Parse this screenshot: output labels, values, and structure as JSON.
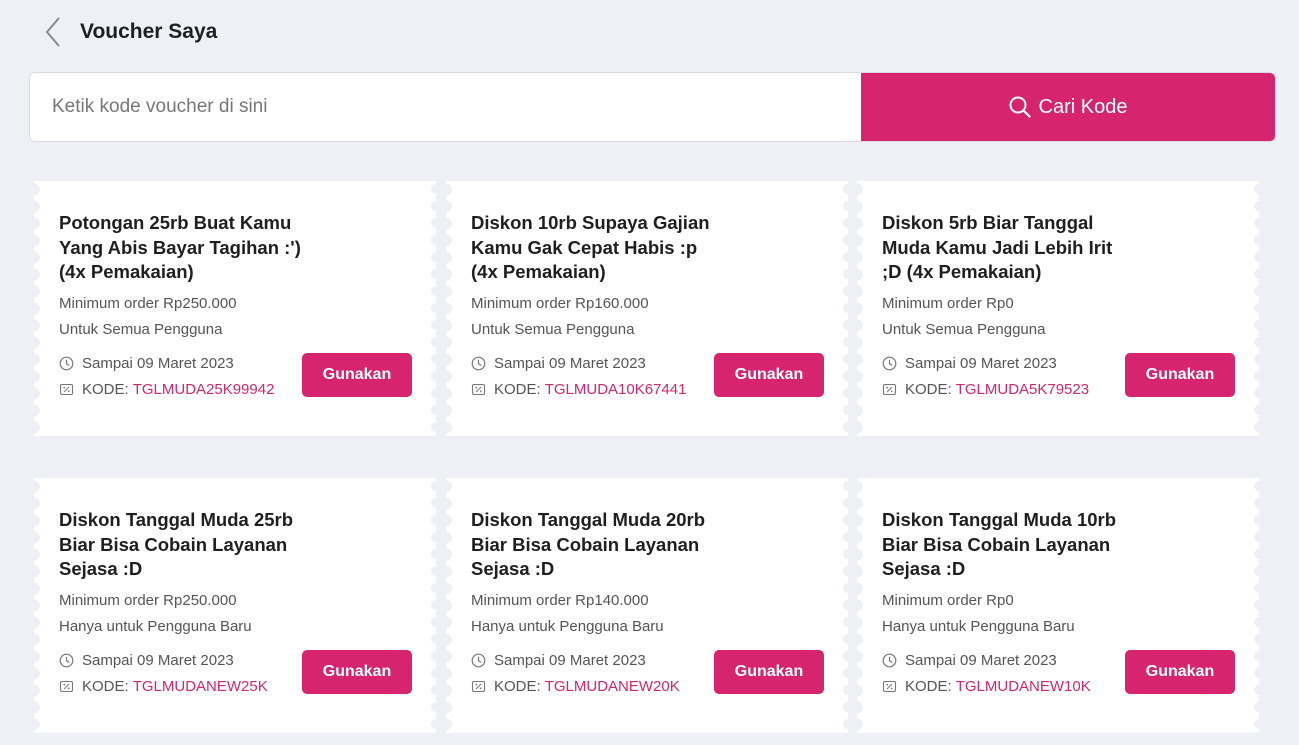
{
  "header": {
    "title": "Voucher Saya",
    "back_icon": "chevron-left-icon"
  },
  "search": {
    "placeholder": "Ketik kode voucher di sini",
    "value": "",
    "button_label": "Cari Kode",
    "button_icon": "search-icon"
  },
  "colors": {
    "accent": "#d6246e",
    "background": "#eef0f5",
    "card": "#ffffff"
  },
  "labels": {
    "expiry_prefix": "Sampai",
    "code_prefix": "KODE:",
    "use_button": "Gunakan"
  },
  "vouchers": [
    {
      "title": "Potongan 25rb Buat Kamu Yang Abis Bayar Tagihan :') (4x Pemakaian)",
      "min_order": "Minimum order Rp250.000",
      "users": "Untuk Semua Pengguna",
      "expiry": "Sampai 09 Maret 2023",
      "code_label": "KODE:",
      "code": "TGLMUDA25K99942",
      "button": "Gunakan"
    },
    {
      "title": "Diskon 10rb Supaya Gajian Kamu Gak Cepat Habis :p (4x Pemakaian)",
      "min_order": "Minimum order Rp160.000",
      "users": "Untuk Semua Pengguna",
      "expiry": "Sampai 09 Maret 2023",
      "code_label": "KODE:",
      "code": "TGLMUDA10K67441",
      "button": "Gunakan"
    },
    {
      "title": "Diskon 5rb Biar Tanggal Muda Kamu Jadi Lebih Irit ;D (4x Pemakaian)",
      "min_order": "Minimum order Rp0",
      "users": "Untuk Semua Pengguna",
      "expiry": "Sampai 09 Maret 2023",
      "code_label": "KODE:",
      "code": "TGLMUDA5K79523",
      "button": "Gunakan"
    },
    {
      "title": "Diskon Tanggal Muda 25rb Biar Bisa Cobain Layanan Sejasa :D",
      "min_order": "Minimum order Rp250.000",
      "users": "Hanya untuk Pengguna Baru",
      "expiry": "Sampai 09 Maret 2023",
      "code_label": "KODE:",
      "code": "TGLMUDANEW25K",
      "button": "Gunakan"
    },
    {
      "title": "Diskon Tanggal Muda 20rb Biar Bisa Cobain Layanan Sejasa :D",
      "min_order": "Minimum order Rp140.000",
      "users": "Hanya untuk Pengguna Baru",
      "expiry": "Sampai 09 Maret 2023",
      "code_label": "KODE:",
      "code": "TGLMUDANEW20K",
      "button": "Gunakan"
    },
    {
      "title": "Diskon Tanggal Muda 10rb Biar Bisa Cobain Layanan Sejasa :D",
      "min_order": "Minimum order Rp0",
      "users": "Hanya untuk Pengguna Baru",
      "expiry": "Sampai 09 Maret 2023",
      "code_label": "KODE:",
      "code": "TGLMUDANEW10K",
      "button": "Gunakan"
    }
  ]
}
